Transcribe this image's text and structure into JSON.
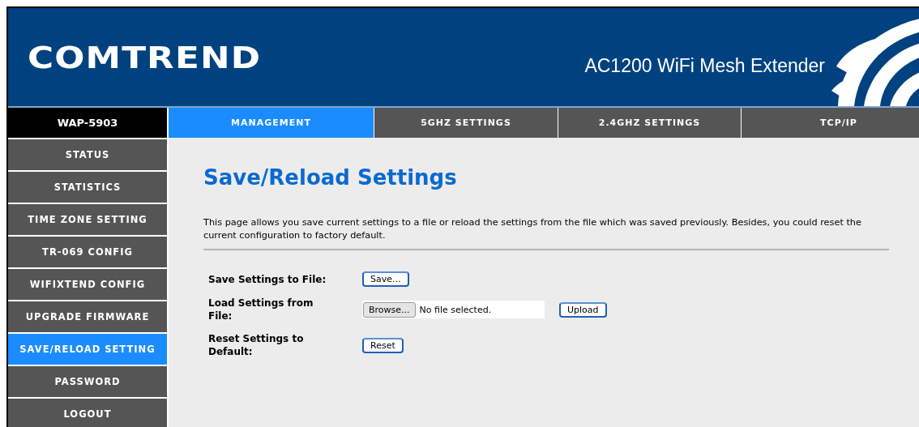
{
  "header": {
    "logo": "COMTREND",
    "product": "AC1200 WiFi Mesh Extender"
  },
  "model": "WAP-5903",
  "tabs": [
    {
      "label": "MANAGEMENT",
      "selected": true
    },
    {
      "label": "5GHZ SETTINGS",
      "selected": false
    },
    {
      "label": "2.4GHZ SETTINGS",
      "selected": false
    },
    {
      "label": "TCP/IP",
      "selected": false
    }
  ],
  "sidebar": {
    "items": [
      {
        "label": "STATUS",
        "selected": false
      },
      {
        "label": "STATISTICS",
        "selected": false
      },
      {
        "label": "TIME ZONE SETTING",
        "selected": false
      },
      {
        "label": "TR-069 CONFIG",
        "selected": false
      },
      {
        "label": "WIFIXTEND CONFIG",
        "selected": false
      },
      {
        "label": "UPGRADE FIRMWARE",
        "selected": false
      },
      {
        "label": "SAVE/RELOAD SETTING",
        "selected": true
      },
      {
        "label": "PASSWORD",
        "selected": false
      },
      {
        "label": "LOGOUT",
        "selected": false
      }
    ]
  },
  "page": {
    "title": "Save/Reload Settings",
    "description": "This page allows you save current settings to a file or reload the settings from the file which was saved previously. Besides, you could reset the current configuration to factory default.",
    "rows": [
      {
        "kind": "button",
        "label": "Save Settings to File:",
        "button": "Save..."
      },
      {
        "kind": "file",
        "label": "Load Settings from File:",
        "browse": "Browse...",
        "file_status": "No file selected.",
        "button": "Upload"
      },
      {
        "kind": "button",
        "label": "Reset Settings to Default:",
        "button": "Reset"
      }
    ]
  }
}
